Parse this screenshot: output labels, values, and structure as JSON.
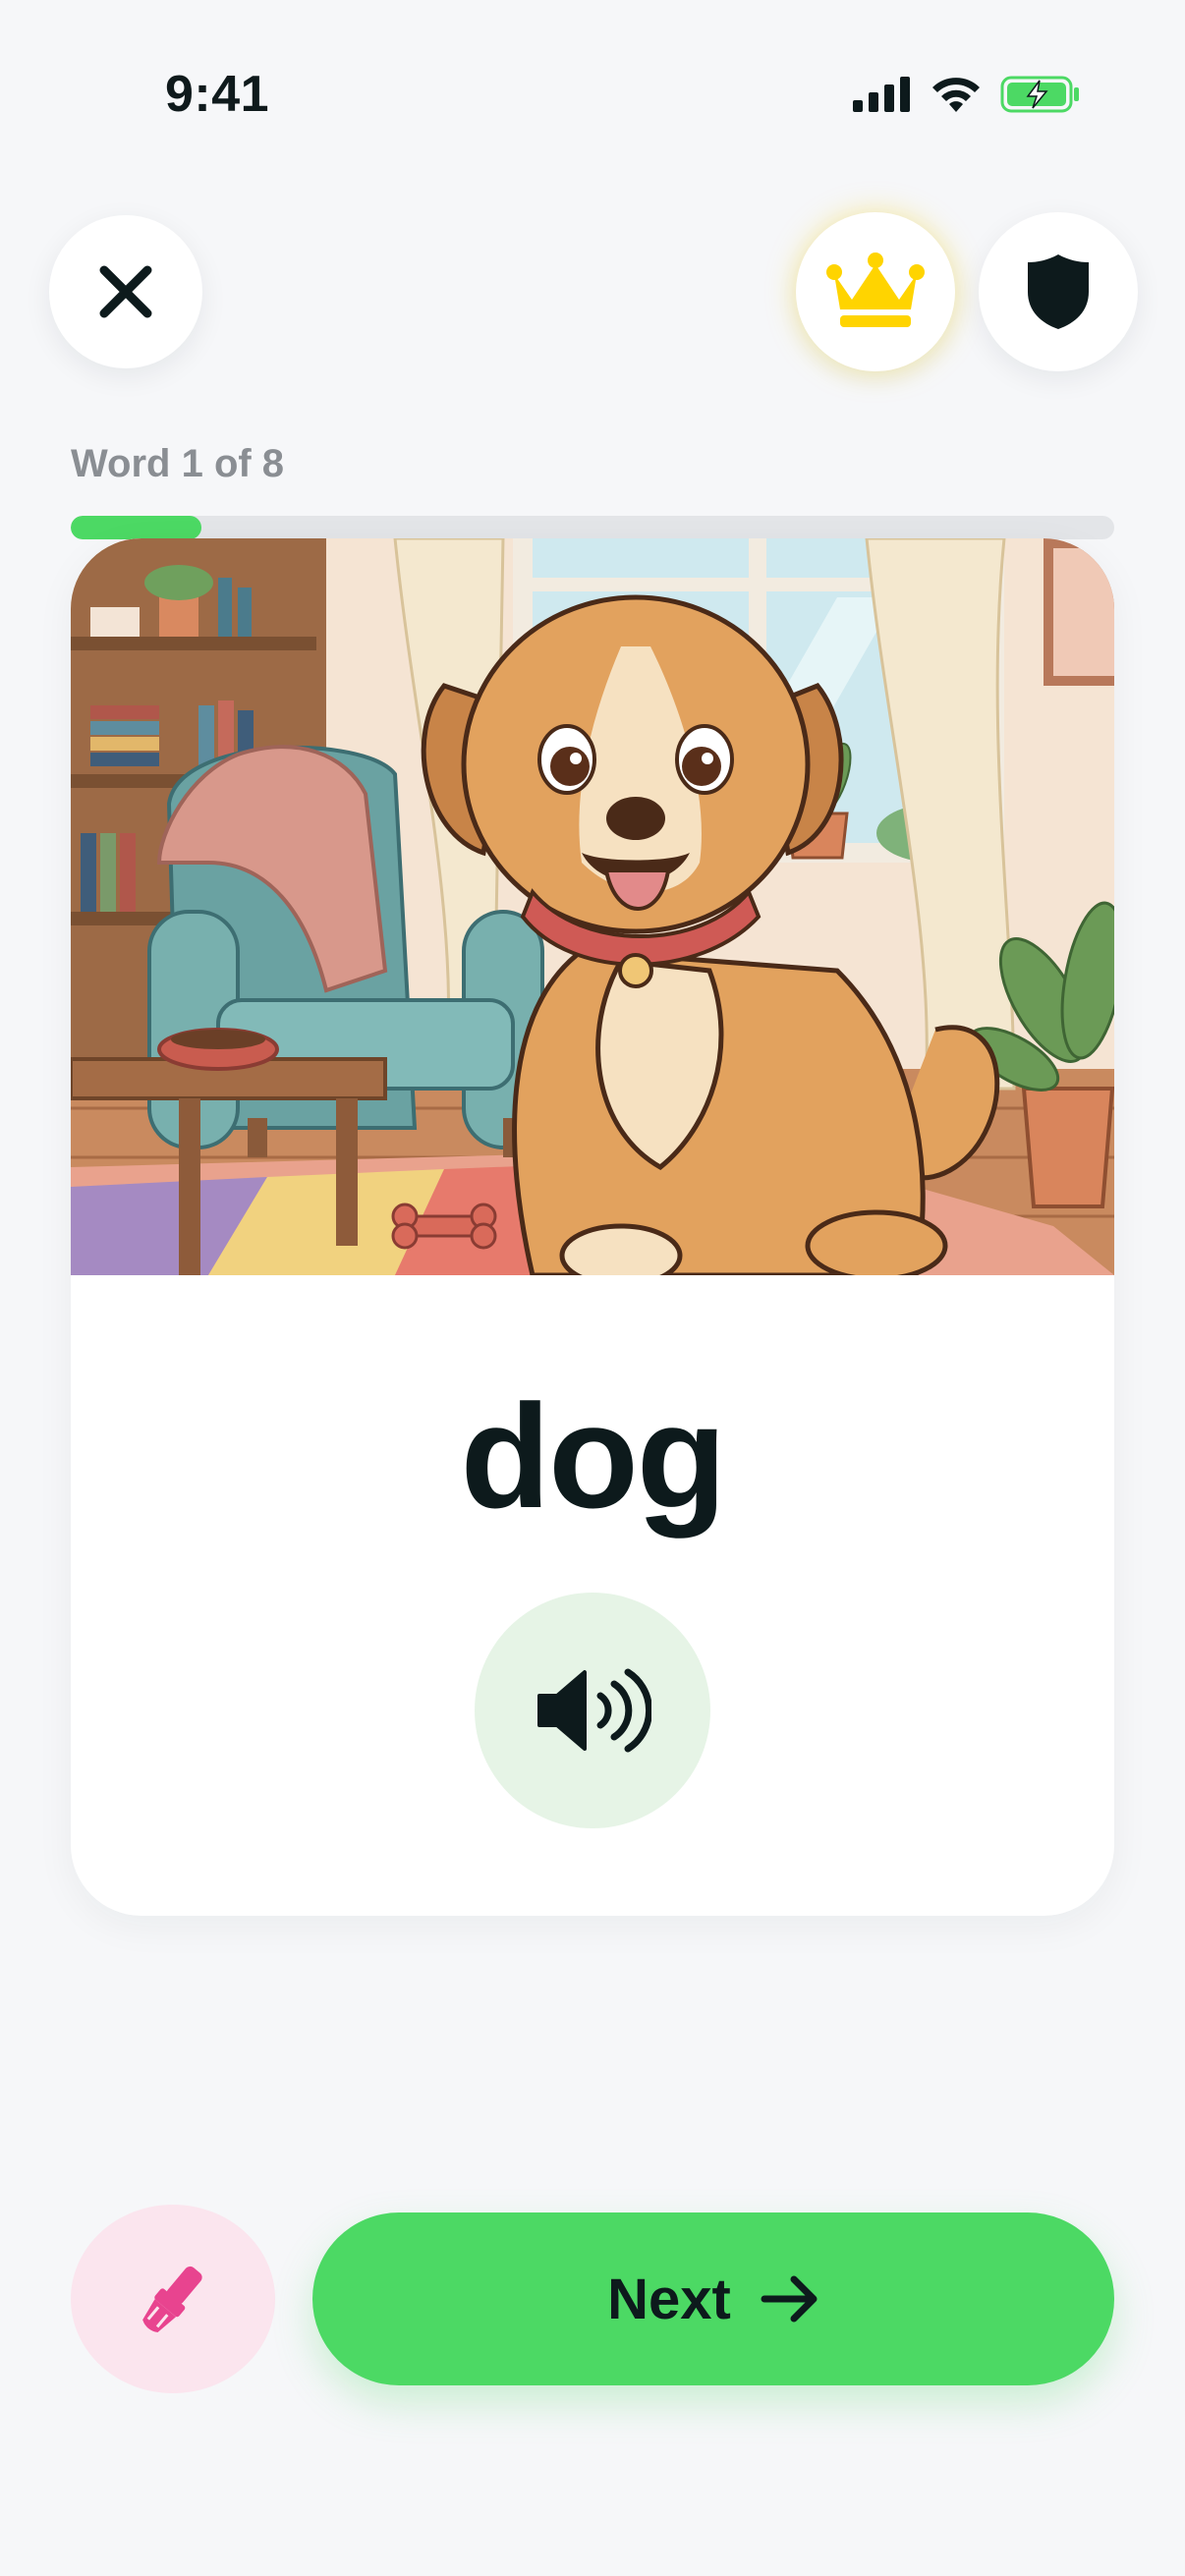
{
  "status_bar": {
    "time": "9:41"
  },
  "header": {
    "close_icon": "close-icon",
    "premium_icon": "crown-icon",
    "shield_icon": "shield-icon"
  },
  "progress": {
    "label": "Word 1 of 8",
    "current": 1,
    "total": 8,
    "fraction": 0.125
  },
  "card": {
    "image": "illustration of a smiling dog with red collar sitting in a cozy living room",
    "word": "dog",
    "audio_icon": "speaker-icon"
  },
  "actions": {
    "brush_icon": "paintbrush-icon",
    "next_label": "Next",
    "next_icon": "arrow-right-icon"
  },
  "colors": {
    "accent_green": "#4cd964",
    "crown_yellow": "#ffd400",
    "brush_pink": "#e8448f",
    "text_dark": "#0d1a1c"
  }
}
